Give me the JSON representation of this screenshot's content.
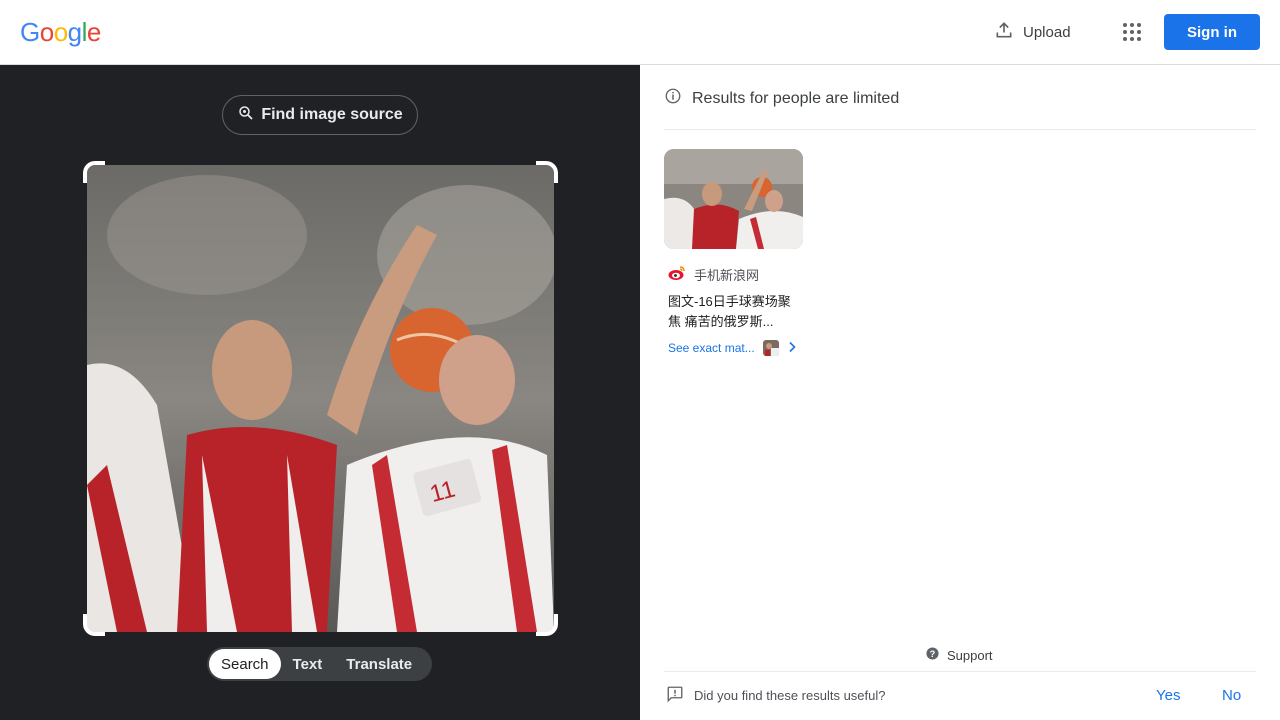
{
  "header": {
    "logo_letters": [
      "G",
      "o",
      "o",
      "g",
      "l",
      "e"
    ],
    "logo_colors": [
      "#4285F4",
      "#EA4335",
      "#FBBC05",
      "#4285F4",
      "#34A853",
      "#EA4335"
    ],
    "upload_label": "Upload",
    "apps_icon": "apps-grid-icon",
    "signin_label": "Sign in"
  },
  "left_panel": {
    "find_source_label": "Find image source",
    "find_source_icon": "lens-search-icon",
    "image_subject": "handball players, one in red and white shirt throwing ball",
    "modes": [
      {
        "label": "Search",
        "active": true
      },
      {
        "label": "Text",
        "active": false
      },
      {
        "label": "Translate",
        "active": false
      }
    ]
  },
  "right_panel": {
    "notice": "Results for people are limited",
    "notice_icon": "info-icon",
    "results": [
      {
        "source_name": "手机新浪网",
        "source_icon": "weibo-icon",
        "title": "图文-16日手球赛场聚焦 痛苦的俄罗斯...",
        "exact_match_label": "See exact mat...",
        "chevron_icon": "chevron-right-icon"
      }
    ],
    "support_label": "Support",
    "support_icon": "help-icon",
    "feedback_question": "Did you find these results useful?",
    "feedback_icon": "feedback-icon",
    "feedback_yes": "Yes",
    "feedback_no": "No"
  },
  "colors": {
    "accent": "#1a73e8",
    "dark_panel": "#202124"
  }
}
